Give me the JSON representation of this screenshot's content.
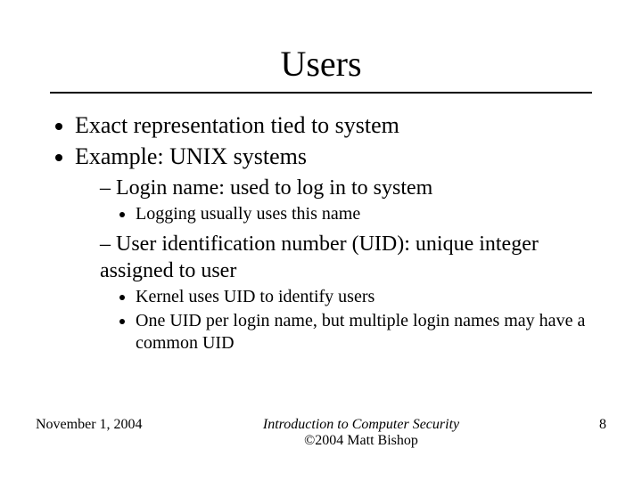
{
  "title": "Users",
  "bullets": {
    "b1": "Exact representation tied to system",
    "b2": "Example: UNIX systems",
    "b2_1": "Login name: used to log in to system",
    "b2_1_1": "Logging usually uses this name",
    "b2_2": "User identification number (UID): unique integer assigned to user",
    "b2_2_1": "Kernel uses UID to identify users",
    "b2_2_2": "One UID per login name, but multiple login names may have a common UID"
  },
  "footer": {
    "date": "November 1, 2004",
    "center_line1": "Introduction to Computer Security",
    "center_line2": "©2004 Matt Bishop",
    "page": "8"
  }
}
